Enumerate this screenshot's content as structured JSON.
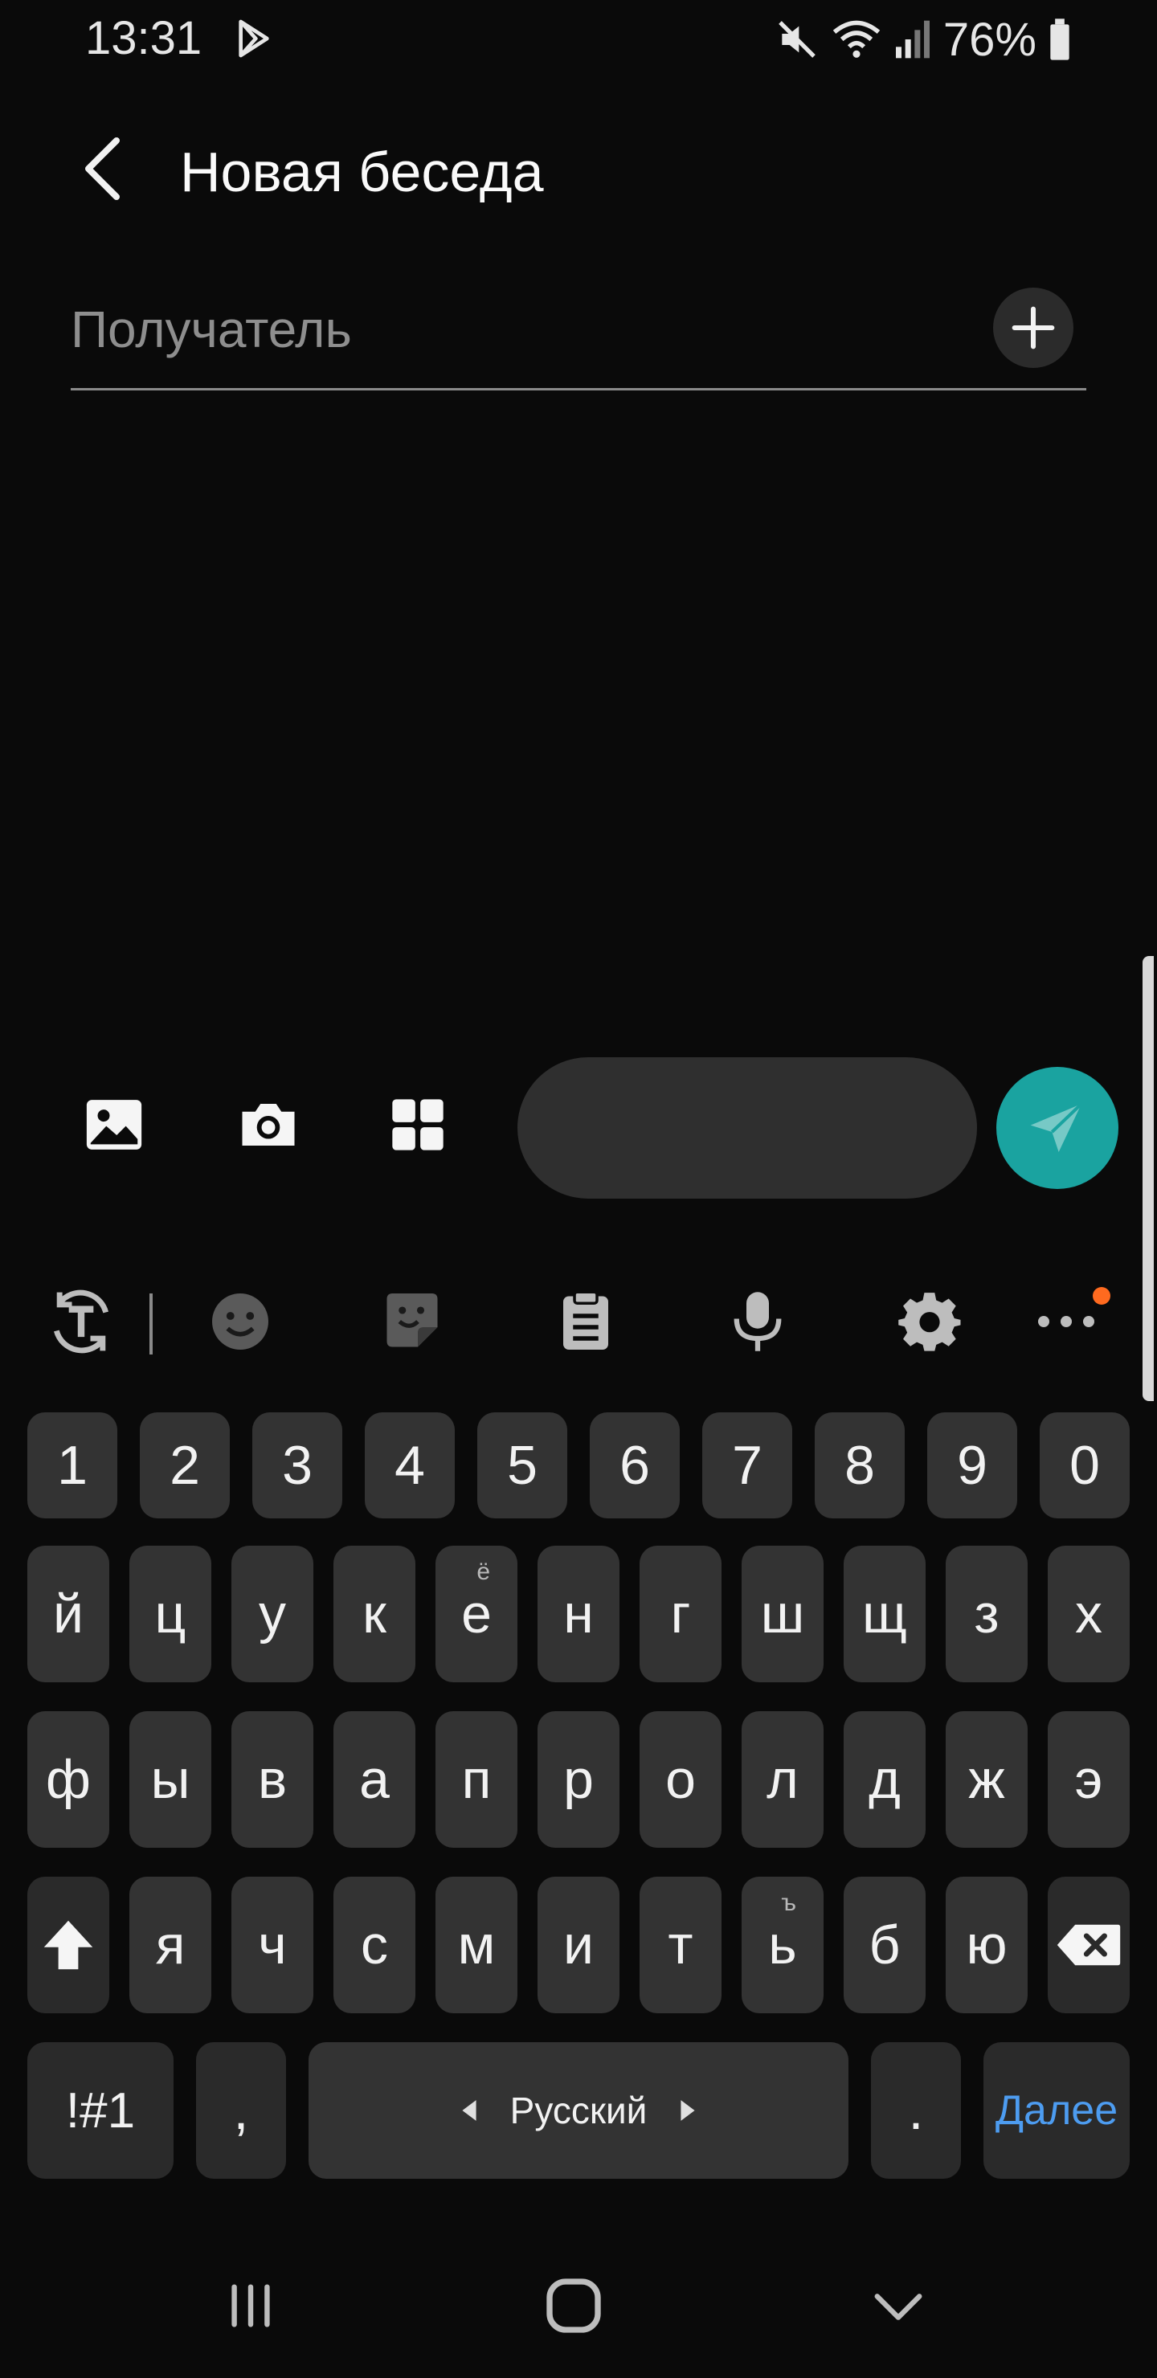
{
  "status_bar": {
    "time": "13:31",
    "battery": "76%",
    "icons": [
      "play-store-icon",
      "mute-icon",
      "wifi-icon",
      "signal-icon",
      "battery-icon"
    ]
  },
  "header": {
    "title": "Новая беседа",
    "back_icon": "back-chevron-icon"
  },
  "recipient": {
    "placeholder": "Получатель",
    "value": "",
    "add_icon": "plus-icon"
  },
  "composer": {
    "message_value": "",
    "icons": [
      "gallery-icon",
      "camera-icon",
      "apps-grid-icon",
      "send-icon"
    ],
    "send_color": "#1aa3a0"
  },
  "keyboard_toolbar": {
    "icons": [
      "text-conversion-icon",
      "emoji-icon",
      "sticker-icon",
      "clipboard-icon",
      "microphone-icon",
      "settings-gear-icon",
      "more-dots-icon"
    ],
    "notification_dot_color": "#ff6a1f"
  },
  "keyboard": {
    "number_row": [
      "1",
      "2",
      "3",
      "4",
      "5",
      "6",
      "7",
      "8",
      "9",
      "0"
    ],
    "row1": [
      "й",
      "ц",
      "у",
      "к",
      "е",
      "н",
      "г",
      "ш",
      "щ",
      "з",
      "х"
    ],
    "row1_hint_e": "ё",
    "row2": [
      "ф",
      "ы",
      "в",
      "а",
      "п",
      "р",
      "о",
      "л",
      "д",
      "ж",
      "э"
    ],
    "row3": [
      "я",
      "ч",
      "с",
      "м",
      "и",
      "т",
      "ь",
      "б",
      "ю"
    ],
    "row3_hint_soft": "ъ",
    "symbols_label": "!#1",
    "comma": ",",
    "language": "Русский",
    "period": ".",
    "next_label": "Далее",
    "next_color": "#4d9cf0"
  },
  "nav_bar": {
    "icons": [
      "recents-icon",
      "home-icon",
      "keyboard-hide-icon"
    ]
  }
}
